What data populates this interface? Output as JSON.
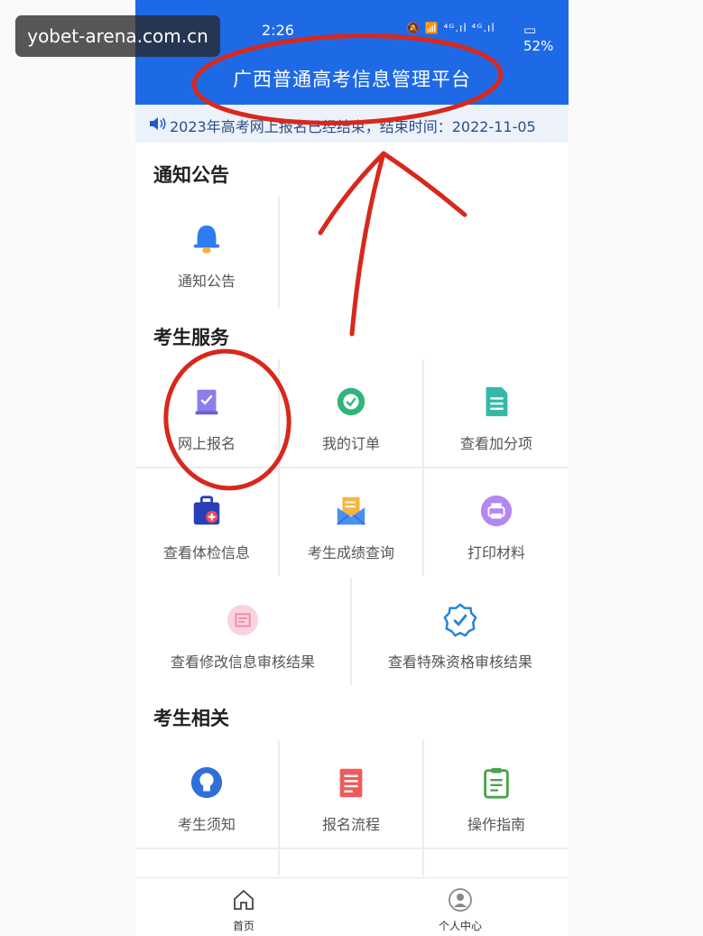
{
  "watermark": "yobet-arena.com.cn",
  "status_bar": {
    "time": "2:26",
    "signal": "⁴ᴳ.ıl ⁴ᴳ.ıl",
    "battery": "52%"
  },
  "app_title": "广西普通高考信息管理平台",
  "notice": {
    "text": "2023年高考网上报名已经结束，结束时间：2022-11-05"
  },
  "sections": {
    "notices": {
      "title": "通知公告",
      "items": [
        {
          "label": "通知公告",
          "icon": "bell-icon"
        }
      ]
    },
    "services": {
      "title": "考生服务",
      "items": [
        {
          "label": "网上报名",
          "icon": "registration-book-icon"
        },
        {
          "label": "我的订单",
          "icon": "order-check-icon"
        },
        {
          "label": "查看加分项",
          "icon": "document-list-icon"
        },
        {
          "label": "查看体检信息",
          "icon": "medical-kit-icon"
        },
        {
          "label": "考生成绩查询",
          "icon": "score-envelope-icon"
        },
        {
          "label": "打印材料",
          "icon": "printer-icon"
        },
        {
          "label": "查看修改信息审核结果",
          "icon": "edit-review-icon"
        },
        {
          "label": "查看特殊资格审核结果",
          "icon": "verified-badge-icon"
        }
      ]
    },
    "related": {
      "title": "考生相关",
      "items": [
        {
          "label": "考生须知",
          "icon": "lightbulb-icon"
        },
        {
          "label": "报名流程",
          "icon": "process-document-icon"
        },
        {
          "label": "操作指南",
          "icon": "guide-clipboard-icon"
        }
      ]
    }
  },
  "tabbar": [
    {
      "label": "首页",
      "icon": "home-icon"
    },
    {
      "label": "个人中心",
      "icon": "user-center-icon"
    }
  ],
  "colors": {
    "header": "#1e6ae6",
    "annotation": "#d8281c"
  }
}
